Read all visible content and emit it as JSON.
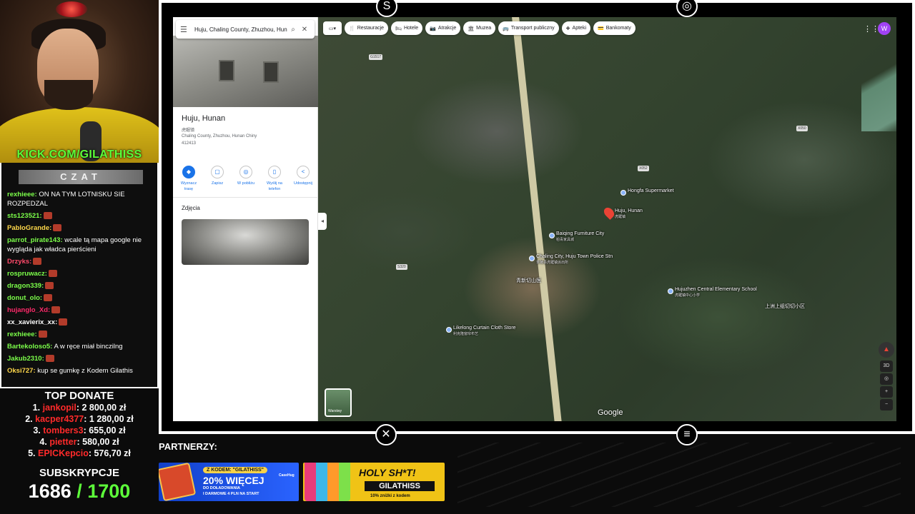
{
  "overlay": {
    "kick_url": "KICK.COM/GILATHISS",
    "chat_title": "CZAT",
    "chat_messages": [
      {
        "user": "rexhieee:",
        "text": "ON NA TYM LOTNISKU SIE ROZPEDZAL",
        "color": "#7cff4a"
      },
      {
        "user": "sts123521:",
        "text": "",
        "color": "#7cff4a"
      },
      {
        "user": "PabloGrande:",
        "text": "",
        "color": "#ffd84a"
      },
      {
        "user": "parrot_pirate143:",
        "text": "wcale tą mapa google nie wygląda jak władca pierścieni",
        "color": "#7cff4a"
      },
      {
        "user": "Drzyks:",
        "text": "",
        "color": "#ff4a6a"
      },
      {
        "user": "rospruwacz:",
        "text": "",
        "color": "#7cff4a"
      },
      {
        "user": "dragon339:",
        "text": "",
        "color": "#7cff4a"
      },
      {
        "user": "donut_olo:",
        "text": "",
        "color": "#7cff4a"
      },
      {
        "user": "hujanglo_Xd:",
        "text": "",
        "color": "#ff2a6a"
      },
      {
        "user": "xx_xavierix_xx:",
        "text": "",
        "color": "#ffffff"
      },
      {
        "user": "rexhieee:",
        "text": "",
        "color": "#7cff4a"
      },
      {
        "user": "Bartekoloso5:",
        "text": "A w ręce miał binczilng",
        "color": "#7cff4a"
      },
      {
        "user": "Jakub2310:",
        "text": "",
        "color": "#7cff4a"
      },
      {
        "user": "Oksi727:",
        "text": "kup se gumkę z Kodem Gilathis",
        "color": "#ffd84a"
      }
    ],
    "top_donate_title": "TOP DONATE",
    "donations": [
      {
        "rank": "1.",
        "name": "jankopil",
        "amount": ": 2 800,00 zł"
      },
      {
        "rank": "2.",
        "name": "kacper4377",
        "amount": ": 1 280,00 zł"
      },
      {
        "rank": "3.",
        "name": "tombers3",
        "amount": ": 655,00 zł"
      },
      {
        "rank": "4.",
        "name": "pietter",
        "amount": ": 580,00 zł"
      },
      {
        "rank": "5.",
        "name": "EPICKepcio",
        "amount": ": 576,70 zł"
      }
    ],
    "subs_title": "SUBSKRYPCJE",
    "subs_count": "1686",
    "subs_goal": " / 1700",
    "partners_label": "PARTNERZY:",
    "banner_casehug": {
      "code": "Z KODEM: \"GILATHISS\"",
      "brand": "CaseHug",
      "headline": "20% WIĘCEJ",
      "sub": "DO DOŁADOWANIA",
      "footer": "I DARMOWE 4 PLN NA START"
    },
    "banner_holy": {
      "headline": "HOLY SH*T!",
      "code": "GILATHISS",
      "footer": "10% zniżki z kodem"
    }
  },
  "maps": {
    "search_value": "Huju, Chaling County, Zhuzhou, Hunan",
    "place_title": "Huju, Hunan",
    "place_local": "虎踞镇",
    "place_address": "Chaling County, Zhuzhou, Hunan Chiny 412413",
    "actions": [
      {
        "icon": "◆",
        "label": "Wyznacz trasę",
        "name": "directions"
      },
      {
        "icon": "▢",
        "label": "Zapisz",
        "name": "save"
      },
      {
        "icon": "◎",
        "label": "W pobliżu",
        "name": "nearby"
      },
      {
        "icon": "▯",
        "label": "Wyślij na telefon",
        "name": "send-to-phone"
      },
      {
        "icon": "<",
        "label": "Udostępnij",
        "name": "share"
      }
    ],
    "photos_label": "Zdjęcia",
    "chips": [
      {
        "icon": "🍴",
        "label": "Restauracje",
        "name": "restaurants"
      },
      {
        "icon": "🛏",
        "label": "Hotele",
        "name": "hotels"
      },
      {
        "icon": "📷",
        "label": "Atrakcje",
        "name": "attractions"
      },
      {
        "icon": "🏛",
        "label": "Muzea",
        "name": "museums"
      },
      {
        "icon": "🚌",
        "label": "Transport publiczny",
        "name": "transit"
      },
      {
        "icon": "✚",
        "label": "Apteki",
        "name": "pharmacies"
      },
      {
        "icon": "💳",
        "label": "Bankomaty",
        "name": "atms"
      }
    ],
    "avatar_letter": "W",
    "layers_label": "Warstwy",
    "google_logo": "Google",
    "labels": [
      {
        "name": "hongfa-supermarket",
        "text": "Hongfa Supermarket",
        "sub": ""
      },
      {
        "name": "huju-hunan",
        "text": "Huju, Hunan",
        "sub": "虎踞镇"
      },
      {
        "name": "baiqing-furniture",
        "text": "Baiqing Furniture City",
        "sub": "柏青家具城"
      },
      {
        "name": "chaling-police",
        "text": "Chaling City, Huju Town Police Stn",
        "sub": "茶陵县虎踞镇派出所"
      },
      {
        "name": "huju-school",
        "text": "Hujuzhen Central Elementary School",
        "sub": "虎踞镇中心小学"
      },
      {
        "name": "likelong-store",
        "text": "Likelong Curtain Cloth Store",
        "sub": "利克隆窗帘布艺"
      },
      {
        "name": "local-1",
        "text": "青新切山医",
        "sub": ""
      },
      {
        "name": "local-2",
        "text": "上洲上组切切小区",
        "sub": ""
      }
    ],
    "road_shields": [
      "G1517",
      "X052",
      "S320",
      "X050"
    ],
    "controls": [
      "3D",
      "◎",
      "+",
      "−"
    ]
  }
}
